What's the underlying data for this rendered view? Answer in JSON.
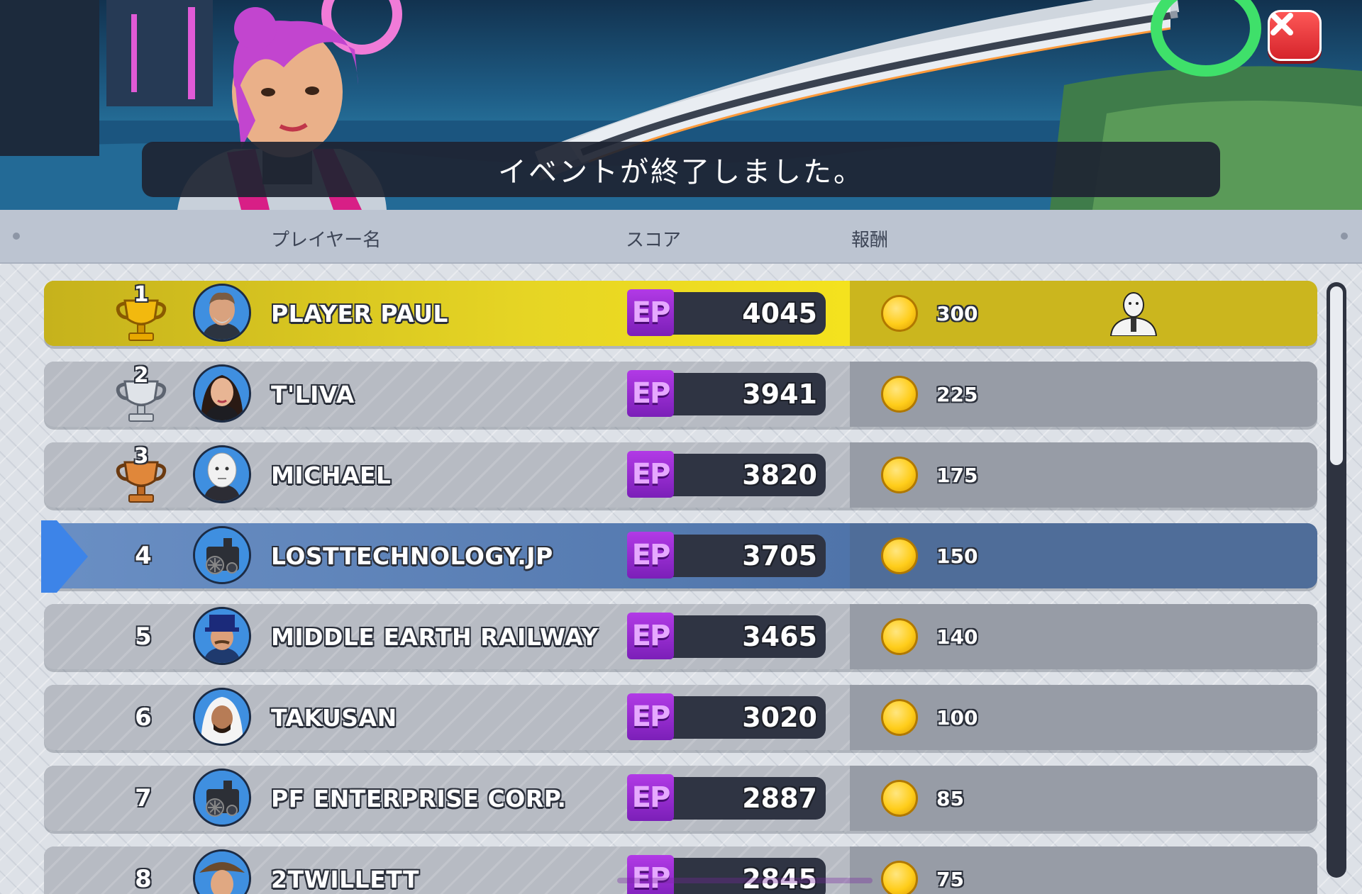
{
  "banner": {
    "message": "イベントが終了しました。"
  },
  "header": {
    "player_name": "プレイヤー名",
    "score": "スコア",
    "reward": "報酬"
  },
  "rows": [
    {
      "rank": "1",
      "name": "PLAYER PAUL",
      "score_prefix": "EP",
      "score": "4045",
      "reward": "300"
    },
    {
      "rank": "2",
      "name": "T'LIVA",
      "score_prefix": "EP",
      "score": "3941",
      "reward": "225"
    },
    {
      "rank": "3",
      "name": "MICHAEL",
      "score_prefix": "EP",
      "score": "3820",
      "reward": "175"
    },
    {
      "rank": "4",
      "name": "LOSTTECHNOLOGY.JP",
      "score_prefix": "EP",
      "score": "3705",
      "reward": "150"
    },
    {
      "rank": "5",
      "name": "MIDDLE EARTH RAILWAY",
      "score_prefix": "EP",
      "score": "3465",
      "reward": "140"
    },
    {
      "rank": "6",
      "name": "TAKUSAN",
      "score_prefix": "EP",
      "score": "3020",
      "reward": "100"
    },
    {
      "rank": "7",
      "name": "PF ENTERPRISE CORP.",
      "score_prefix": "EP",
      "score": "2887",
      "reward": "85"
    },
    {
      "rank": "8",
      "name": "2TWILLETT",
      "score_prefix": "EP",
      "score": "2845",
      "reward": "75"
    }
  ],
  "colors": {
    "first_place": "#e6d524",
    "current_player": "#5b7fb4",
    "ep_badge": "#9b2fd6",
    "close_button": "#e0312f"
  },
  "icons": {
    "close": "close-icon",
    "coin": "coin-icon",
    "trophy_gold": "gold-trophy-icon",
    "trophy_silver": "silver-trophy-icon",
    "trophy_bronze": "bronze-trophy-icon",
    "bonus": "robot-reward-icon"
  }
}
